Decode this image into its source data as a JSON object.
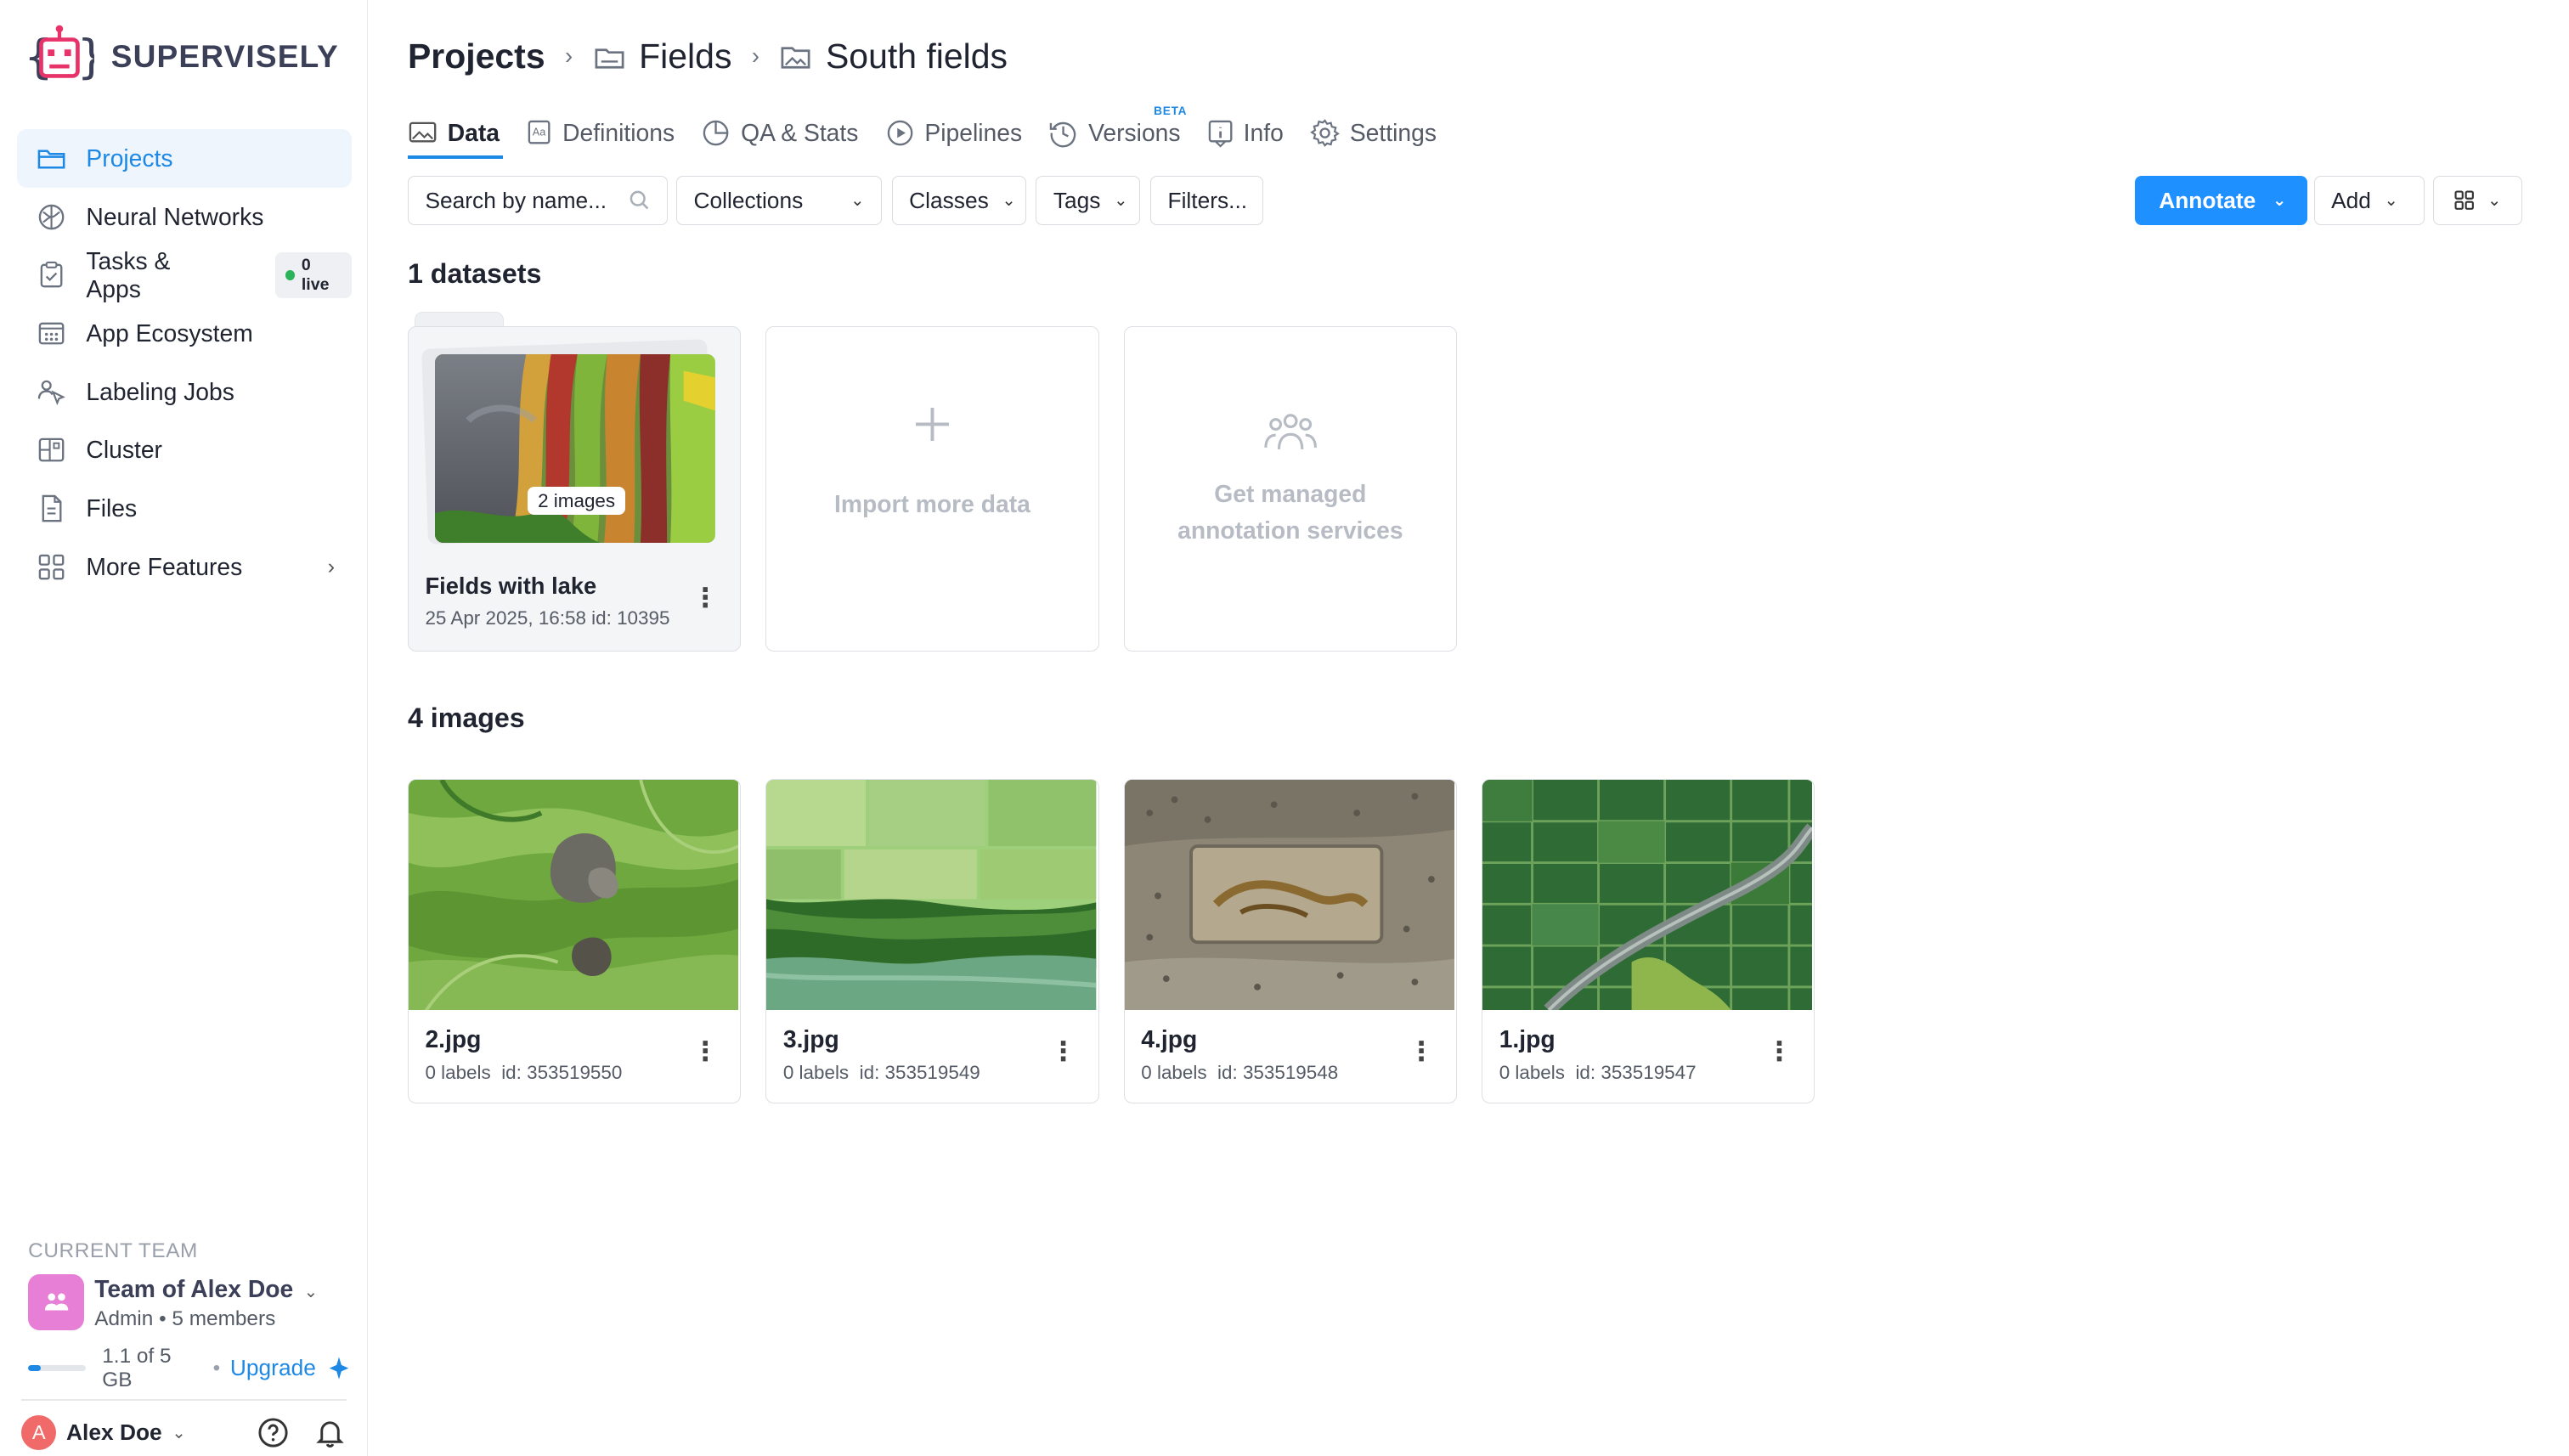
{
  "brand": {
    "name": "SUPERVISELY",
    "accent": "#e8336a",
    "primary": "#1e88e5"
  },
  "sidebar": {
    "items": [
      {
        "label": "Projects",
        "icon": "folder-icon",
        "active": true
      },
      {
        "label": "Neural Networks",
        "icon": "brain-icon"
      },
      {
        "label": "Tasks & Apps",
        "icon": "clipboard-icon",
        "badge": "0 live"
      },
      {
        "label": "App Ecosystem",
        "icon": "app-grid-icon"
      },
      {
        "label": "Labeling Jobs",
        "icon": "labeling-icon"
      },
      {
        "label": "Cluster",
        "icon": "cluster-icon"
      },
      {
        "label": "Files",
        "icon": "file-icon"
      },
      {
        "label": "More Features",
        "icon": "grid-icon",
        "chevron": "›"
      }
    ]
  },
  "team": {
    "section_label": "CURRENT TEAM",
    "name": "Team of Alex Doe",
    "role": "Admin",
    "members": "5 members",
    "storage": "1.1 of 5 GB",
    "storage_fraction": 0.22,
    "upgrade": "Upgrade"
  },
  "user": {
    "initial": "A",
    "name": "Alex Doe"
  },
  "breadcrumb": {
    "root": "Projects",
    "parent": "Fields",
    "current": "South fields"
  },
  "tabs": [
    {
      "label": "Data",
      "active": true,
      "icon": "image-icon"
    },
    {
      "label": "Definitions",
      "icon": "definitions-icon"
    },
    {
      "label": "QA & Stats",
      "icon": "pie-chart-icon"
    },
    {
      "label": "Pipelines",
      "icon": "play-circle-icon"
    },
    {
      "label": "Versions",
      "icon": "history-icon",
      "badge": "BETA"
    },
    {
      "label": "Info",
      "icon": "info-icon"
    },
    {
      "label": "Settings",
      "icon": "gear-icon"
    }
  ],
  "toolbar": {
    "search_placeholder": "Search by name...",
    "collections": "Collections",
    "classes": "Classes",
    "tags": "Tags",
    "filters": "Filters...",
    "annotate": "Annotate",
    "add": "Add"
  },
  "datasets": {
    "heading": "1 datasets",
    "items": [
      {
        "name": "Fields with lake",
        "meta": "25 Apr 2025, 16:58  id: 10395",
        "count": "2 images"
      }
    ],
    "import_label": "Import more data",
    "managed_label_1": "Get managed",
    "managed_label_2": "annotation services"
  },
  "images": {
    "heading": "4 images",
    "items": [
      {
        "name": "2.jpg",
        "labels": "0 labels",
        "id": "id: 353519550"
      },
      {
        "name": "3.jpg",
        "labels": "0 labels",
        "id": "id: 353519549"
      },
      {
        "name": "4.jpg",
        "labels": "0 labels",
        "id": "id: 353519548"
      },
      {
        "name": "1.jpg",
        "labels": "0 labels",
        "id": "id: 353519547"
      }
    ]
  }
}
